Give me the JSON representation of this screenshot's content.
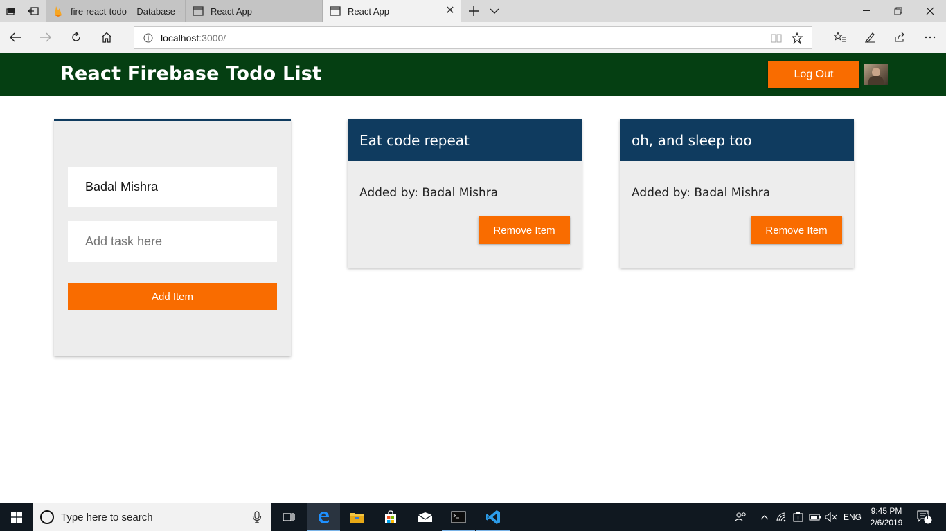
{
  "browser": {
    "tabs": [
      {
        "title": "fire-react-todo – Database -",
        "icon": "firebase-icon",
        "state": "inactive"
      },
      {
        "title": "React App",
        "icon": "page-icon",
        "state": "inactive"
      },
      {
        "title": "React App",
        "icon": "page-icon",
        "state": "active"
      }
    ],
    "address": {
      "host": "localhost",
      "path": ":3000/"
    }
  },
  "app": {
    "title": "React Firebase Todo List",
    "logout_label": "Log Out",
    "form": {
      "name_value": "Badal Mishra",
      "task_placeholder": "Add task here",
      "add_label": "Add Item"
    },
    "todos": [
      {
        "title": "Eat code repeat",
        "added_by": "Added by: Badal Mishra",
        "remove_label": "Remove Item"
      },
      {
        "title": "oh, and sleep too",
        "added_by": "Added by: Badal Mishra",
        "remove_label": "Remove Item"
      }
    ],
    "colors": {
      "header": "#053f12",
      "accent": "#f96c00",
      "card_header": "#0f3b5f"
    }
  },
  "taskbar": {
    "search_placeholder": "Type here to search",
    "language": "ENG",
    "time": "9:45 PM",
    "date": "2/6/2019",
    "notification_count": "1"
  }
}
